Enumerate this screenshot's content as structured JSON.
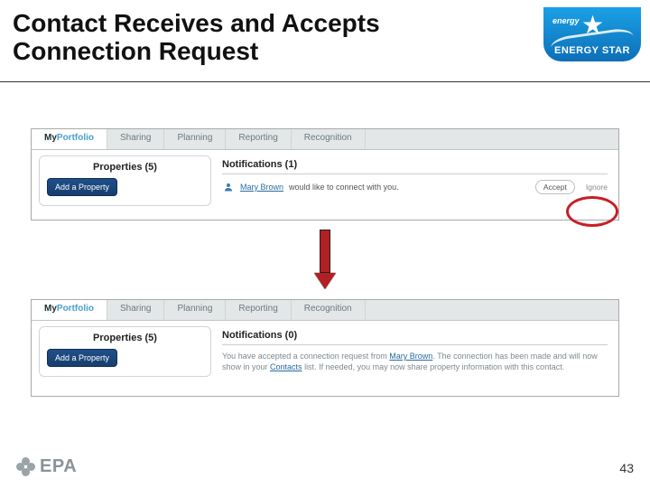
{
  "title": "Contact Receives and Accepts Connection Request",
  "page_number": "43",
  "energy_star": {
    "brand": "ENERGY STAR",
    "small": "energy"
  },
  "epa_text": "EPA",
  "tabs": {
    "t0": "MyPortfolio",
    "t0a": "My",
    "t0b": "Portfolio",
    "t1": "Sharing",
    "t2": "Planning",
    "t3": "Reporting",
    "t4": "Recognition"
  },
  "shot1": {
    "props_title": "Properties (5)",
    "add_btn": "Add a Property",
    "notif_title": "Notifications (1)",
    "user": "Mary Brown",
    "msg_suffix": " would like to connect with you.",
    "accept": "Accept",
    "ignore": "Ignore"
  },
  "shot2": {
    "props_title": "Properties (5)",
    "add_btn": "Add a Property",
    "notif_title": "Notifications (0)",
    "msg_a": "You have accepted a connection request from ",
    "user": "Mary Brown",
    "msg_b": ". The connection has been made and will now show in your ",
    "contacts": "Contacts",
    "msg_c": " list. If needed, you may now share property information with this contact."
  }
}
